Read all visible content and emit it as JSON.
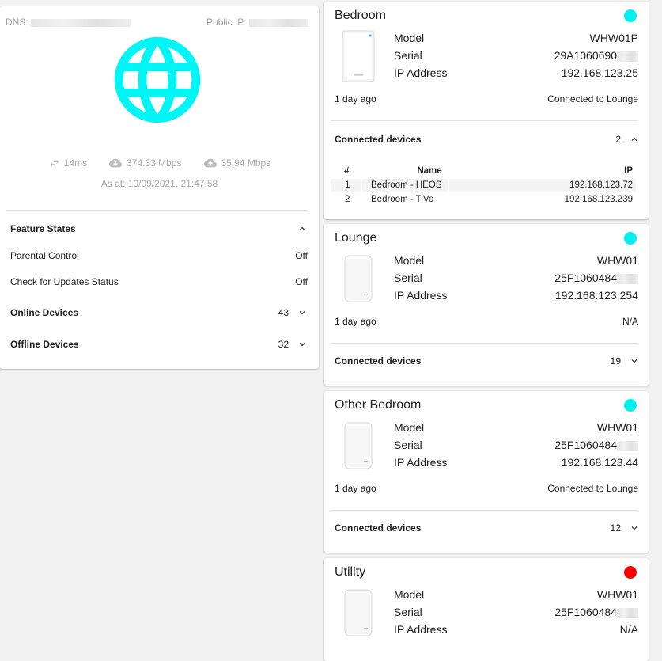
{
  "overview": {
    "dns_label": "DNS:",
    "public_ip_label": "Public IP:",
    "latency": "14ms",
    "download": "374.33 Mbps",
    "upload": "35.94 Mbps",
    "as_at": "As at: 10/09/2021, 21:47:58",
    "globe_color": "#00f5f5",
    "feature_states_label": "Feature States",
    "features": [
      {
        "label": "Parental Control",
        "value": "Off"
      },
      {
        "label": "Check for Updates Status",
        "value": "Off"
      }
    ],
    "online_devices_label": "Online Devices",
    "online_devices_count": "43",
    "offline_devices_label": "Offline Devices",
    "offline_devices_count": "32"
  },
  "labels": {
    "model": "Model",
    "serial": "Serial",
    "ip": "IP Address",
    "connected_devices": "Connected devices",
    "col_num": "#",
    "col_name": "Name",
    "col_ip": "IP"
  },
  "nodes": [
    {
      "name": "Bedroom",
      "status_color": "#00f0f0",
      "model": "WHW01P",
      "serial": "29A1060690",
      "ip": "192.168.123.25",
      "last_seen": "1 day ago",
      "connection": "Connected to Lounge",
      "connected_count": "2",
      "devices": [
        {
          "num": "1",
          "name": "Bedroom - HEOS",
          "ip": "192.168.123.72"
        },
        {
          "num": "2",
          "name": "Bedroom - TiVo",
          "ip": "192.168.123.239"
        }
      ]
    },
    {
      "name": "Lounge",
      "status_color": "#00f0f0",
      "model": "WHW01",
      "serial": "25F1060484",
      "ip": "192.168.123.254",
      "last_seen": "1 day ago",
      "connection": "N/A",
      "connected_count": "19"
    },
    {
      "name": "Other Bedroom",
      "status_color": "#00f0f0",
      "model": "WHW01",
      "serial": "25F1060484",
      "ip": "192.168.123.44",
      "last_seen": "1 day ago",
      "connection": "Connected to Lounge",
      "connected_count": "12"
    },
    {
      "name": "Utility",
      "status_color": "#ff0000",
      "model": "WHW01",
      "serial": "25F1060484",
      "ip": "N/A"
    }
  ]
}
